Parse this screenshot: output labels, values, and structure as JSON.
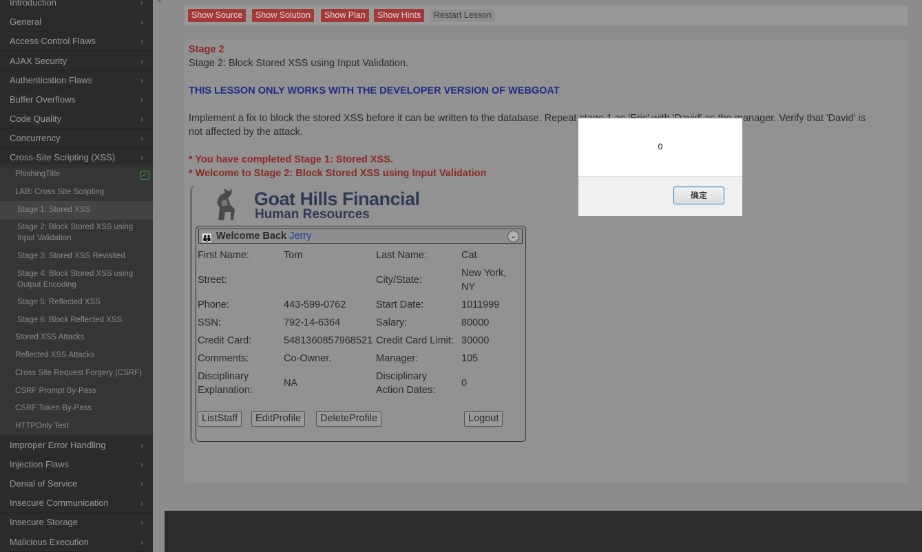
{
  "sidebar": {
    "categories_top": [
      "Introduction",
      "General",
      "Access Control Flaws",
      "AJAX Security",
      "Authentication Flaws",
      "Buffer Overflows",
      "Code Quality",
      "Concurrency",
      "Cross-Site Scripting (XSS)"
    ],
    "xss_items": [
      "PhishingTitle",
      "LAB: Cross Site Scripting",
      "Stage 1: Stored XSS",
      "Stage 2: Block Stored XSS using Input Validation",
      "Stage 3: Stored XSS Revisited",
      "Stage 4: Block Stored XSS using Output Encoding",
      "Stage 5: Reflected XSS",
      "Stage 6: Block Reflected XSS",
      "Stored XSS Attacks",
      "Reflected XSS Attacks",
      "Cross Site Request Forgery (CSRF)",
      "CSRF Prompt By-Pass",
      "CSRF Token By-Pass",
      "HTTPOnly Test"
    ],
    "categories_bottom": [
      "Improper Error Handling",
      "Injection Flaws",
      "Denial of Service",
      "Insecure Communication",
      "Insecure Storage",
      "Malicious Execution"
    ],
    "chevron": "›"
  },
  "toolbar": {
    "show_source": "Show Source",
    "show_solution": "Show Solution",
    "show_plan": "Show Plan",
    "show_hints": "Show Hints",
    "restart_lesson": "Restart Lesson"
  },
  "lesson": {
    "stage_heading": "Stage 2",
    "stage_title": "Stage 2: Block Stored XSS using Input Validation.",
    "developer_warning": "THIS LESSON ONLY WORKS WITH THE DEVELOPER VERSION OF WEBGOAT",
    "instructions_line1": "Implement a fix to block the stored XSS before it can be written to the database. Repeat stage 1 as 'Eric' with 'David' as the manager. Verify that 'David' is",
    "instructions_line2": "not affected by the attack.",
    "message1": "* You have completed Stage 1: Stored XSS.",
    "message2": "* Welcome to Stage 2: Block Stored XSS using Input Validation"
  },
  "app": {
    "logo_title": "Goat Hills Financial",
    "logo_subtitle": "Human Resources",
    "welcome_prefix": "Welcome Back",
    "welcome_user": "Jerry",
    "fields": {
      "first_name_label": "First Name:",
      "first_name": "Tom",
      "last_name_label": "Last Name:",
      "last_name": "Cat",
      "street_label": "Street:",
      "street": "",
      "city_label": "City/State:",
      "city_line1": "New York,",
      "city_line2": "NY",
      "phone_label": "Phone:",
      "phone": "443-599-0762",
      "start_date_label": "Start Date:",
      "start_date": "1011999",
      "ssn_label": "SSN:",
      "ssn": "792-14-6364",
      "salary_label": "Salary:",
      "salary": "80000",
      "credit_card_label": "Credit Card:",
      "credit_card": "5481360857968521",
      "credit_limit_label": "Credit Card Limit:",
      "credit_limit": "30000",
      "comments_label": "Comments:",
      "comments": "Co-Owner.",
      "manager_label": "Manager:",
      "manager": "105",
      "disc_expl_label1": "Disciplinary",
      "disc_expl_label2": "Explanation:",
      "disc_expl": "NA",
      "disc_dates_label1": "Disciplinary",
      "disc_dates_label2": "Action Dates:",
      "disc_dates": "0"
    },
    "buttons": {
      "list_staff": "ListStaff",
      "edit_profile": "EditProfile",
      "delete_profile": "DeleteProfile",
      "logout": "Logout"
    }
  },
  "dialog": {
    "message": "0",
    "ok_label": "确定"
  }
}
